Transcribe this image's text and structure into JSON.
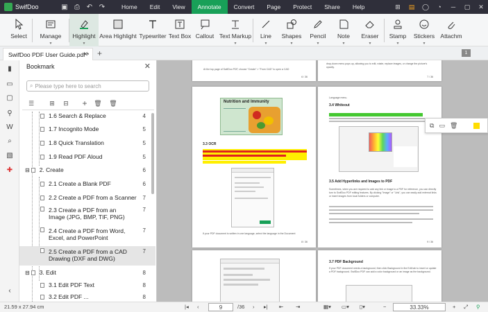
{
  "app": {
    "name": "SwifDoo"
  },
  "menu": [
    "Home",
    "Edit",
    "View",
    "Annotate",
    "Convert",
    "Page",
    "Protect",
    "Share",
    "Help"
  ],
  "menu_active": "Annotate",
  "ribbon": [
    "Select",
    "Manage",
    "Highlight",
    "Area Highlight",
    "Typewriter",
    "Text Box",
    "Callout",
    "Text Markup",
    "Line",
    "Shapes",
    "Pencil",
    "Note",
    "Eraser",
    "Stamp",
    "Stickers",
    "Attachm"
  ],
  "tab": {
    "title": "SwifDoo PDF User Guide.pdf *",
    "page_badge": "1"
  },
  "panel": {
    "title": "Bookmark",
    "search_placeholder": "Please type here to search"
  },
  "bookmarks": [
    {
      "label": "1.6 Search & Replace",
      "page": "4"
    },
    {
      "label": "1.7 Incognito Mode",
      "page": "5"
    },
    {
      "label": "1.8 Quick Translation",
      "page": "5"
    },
    {
      "label": "1.9 Read PDF Aloud",
      "page": "5"
    },
    {
      "label": "2. Create",
      "page": "6"
    },
    {
      "label": "2.1 Create a Blank PDF",
      "page": "6"
    },
    {
      "label": "2.2 Create a PDF from a Scanner",
      "page": "7"
    },
    {
      "label": "2.3 Create a PDF from an Image (JPG, BMP, TIF, PNG)",
      "page": "7"
    },
    {
      "label": "2.4 Create a PDF from Word, Excel, and PowerPoint",
      "page": "7"
    },
    {
      "label": "2.5 Create a PDF from a CAD Drawing (DXF and DWG)",
      "page": "7"
    },
    {
      "label": "3. Edit",
      "page": "8"
    },
    {
      "label": "3.1 Edit PDF Text",
      "page": "8"
    },
    {
      "label": "3.2 Edit PDF ...",
      "page": "8"
    }
  ],
  "pages": {
    "p1_bullet": "At the top page of SwifDoo PDF, choose \"Create\" > \"From CAD\" to open a CAD",
    "p1_num": "6 / 36",
    "p2_text": "drop-down menu pops up, allowing you to edit, rotate, replace images, or change the picture's opacity.",
    "p2_num": "7 / 36",
    "p3_image_title": "Nutrition and Immunity",
    "p3_heading": "3.3 OCR",
    "p3_body": "If your PDF document is written in one language, select the language in the Document",
    "p3_num": "8 / 36",
    "p4_intro": "Language menu.",
    "p4_h1": "3.4 Whiteout",
    "p4_h2": "3.5 Add Hyperlinks and Images to PDF",
    "p4_body": "Sometimes, when you are required to add any link or image to a PDF for reference, you can directly turn to SwifDoo PDF editing features. By clicking \"Image\" or \"Link\", you can easily add external links or insert images from local folders or computer.",
    "p4_num": "9 / 36",
    "p6_heading": "3.7 PDF Background",
    "p6_body": "If your PDF document needs a background, then click Background in the Edit tab to insert or update a PDF background. SwifDoo PDF can add a color background or an image as the background."
  },
  "status": {
    "size": "21.59 x 27.94 cm",
    "page": "9",
    "total": "/36",
    "zoom": "33.33%"
  },
  "colors": {
    "accent": "#18a058",
    "highlight": "#ffef00",
    "redline": "#e02020"
  }
}
